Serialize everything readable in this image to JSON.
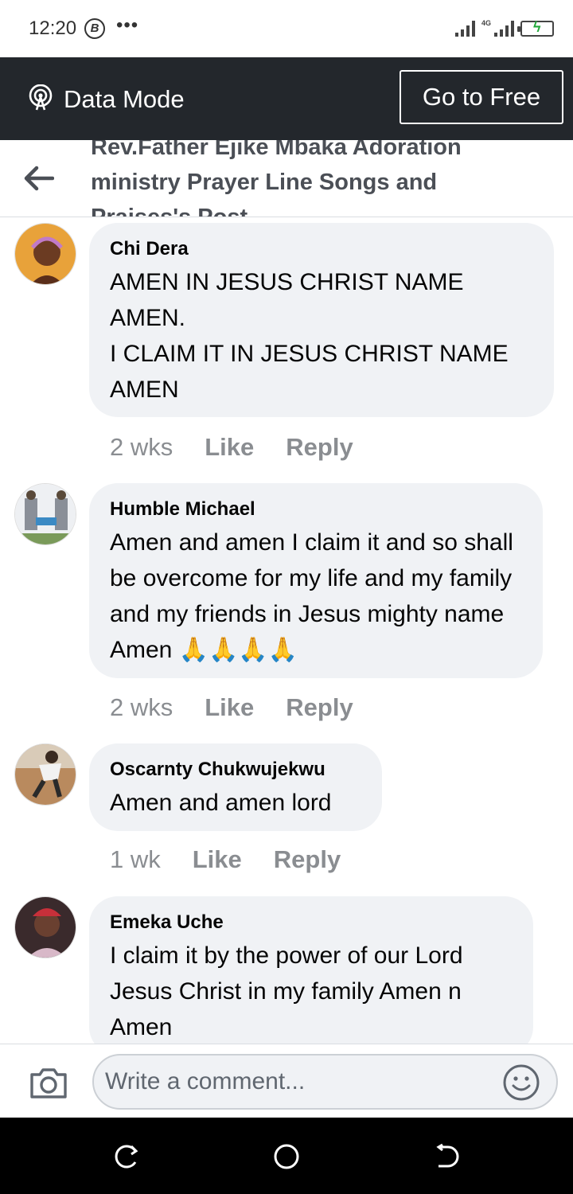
{
  "status_bar": {
    "time": "12:20",
    "b_badge": "B",
    "dots": "•••",
    "network": "4G"
  },
  "data_mode": {
    "label": "Data Mode",
    "button": "Go to Free"
  },
  "header": {
    "title": "Rev.Father Ejike Mbaka Adoration ministry Prayer Line Songs and Praises's Post"
  },
  "comments": [
    {
      "name": "Chi Dera",
      "text": "AMEN IN JESUS CHRIST NAME AMEN.\nI CLAIM IT IN JESUS CHRIST NAME AMEN",
      "time": "2 wks",
      "like": "Like",
      "reply": "Reply"
    },
    {
      "name": "Humble Michael",
      "text": "Amen and amen I claim it and so shall be overcome for my life and my family and my friends in Jesus mighty name Amen",
      "emoji": "🙏🙏🙏🙏",
      "time": "2 wks",
      "like": "Like",
      "reply": "Reply"
    },
    {
      "name": "Oscarnty Chukwujekwu",
      "text": "Amen and amen lord",
      "time": "1 wk",
      "like": "Like",
      "reply": "Reply"
    },
    {
      "name": "Emeka Uche",
      "text": "I claim it by the power of our Lord Jesus Christ in my family Amen n Amen",
      "time": "",
      "like": "",
      "reply": ""
    }
  ],
  "composer": {
    "placeholder": "Write a comment..."
  },
  "colors": {
    "banner": "#23272c",
    "bubble": "#f0f2f5",
    "muted_text": "#8a8d91"
  }
}
